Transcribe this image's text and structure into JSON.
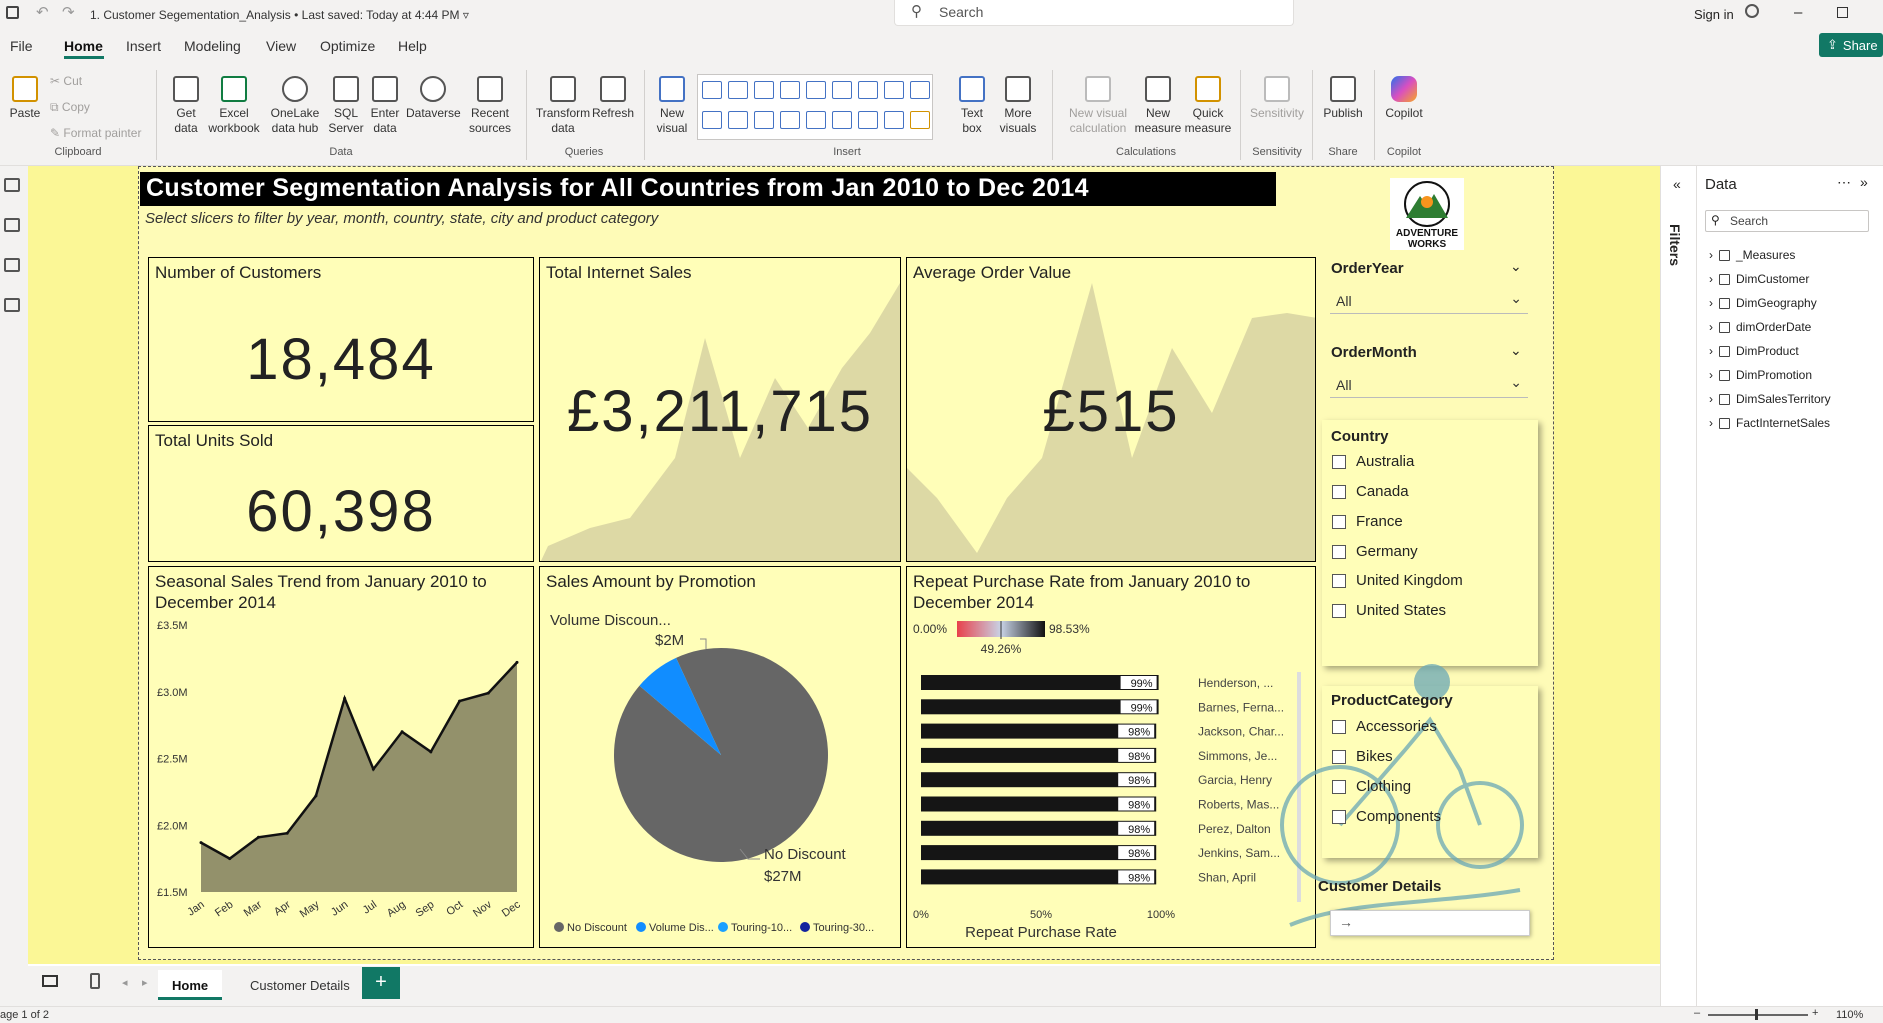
{
  "window": {
    "title": "1. Customer Segementation_Analysis",
    "saved": "• Last saved: Today at 4:44 PM",
    "search_placeholder": "Search",
    "sign_in": "Sign in"
  },
  "menu": {
    "items": [
      "File",
      "Home",
      "Insert",
      "Modeling",
      "View",
      "Optimize",
      "Help"
    ],
    "share": "Share"
  },
  "ribbon": {
    "clipboard": {
      "paste": "Paste",
      "cut": "Cut",
      "copy": "Copy",
      "format_painter": "Format painter",
      "group": "Clipboard"
    },
    "data": {
      "get_data": "Get data",
      "excel": "Excel workbook",
      "onelake": "OneLake data hub",
      "sql": "SQL Server",
      "enter": "Enter data",
      "dataverse": "Dataverse",
      "recent": "Recent sources",
      "group": "Data"
    },
    "queries": {
      "transform": "Transform data",
      "refresh": "Refresh",
      "group": "Queries"
    },
    "insert": {
      "new_visual": "New visual",
      "text_box": "Text box",
      "more_visuals": "More visuals",
      "group": "Insert"
    },
    "calculations": {
      "new_visual_calc": "New visual calculation",
      "new_measure": "New measure",
      "quick_measure": "Quick measure",
      "group": "Calculations"
    },
    "sensitivity": {
      "label": "Sensitivity",
      "group": "Sensitivity"
    },
    "share": {
      "publish": "Publish",
      "group": "Share"
    },
    "copilot": {
      "label": "Copilot",
      "group": "Copilot"
    }
  },
  "report": {
    "title": "Customer Segmentation Analysis for All Countries from Jan 2010 to Dec 2014",
    "subtitle": "Select slicers to filter by year, month, country, state, city and product category",
    "logo_text": "ADVENTURE WORKS",
    "cards": {
      "customers": {
        "label": "Number of Customers",
        "value": "18,484"
      },
      "units": {
        "label": "Total Units Sold",
        "value": "60,398"
      },
      "sales": {
        "label": "Total Internet Sales",
        "value": "£3,211,715"
      },
      "aov": {
        "label": "Average Order Value",
        "value": "£515"
      }
    },
    "slicers": {
      "order_year": {
        "label": "OrderYear",
        "value": "All"
      },
      "order_month": {
        "label": "OrderMonth",
        "value": "All"
      },
      "country": {
        "label": "Country",
        "options": [
          "Australia",
          "Canada",
          "France",
          "Germany",
          "United Kingdom",
          "United States"
        ]
      },
      "product_category": {
        "label": "ProductCategory",
        "options": [
          "Accessories",
          "Bikes",
          "Clothing",
          "Components"
        ]
      }
    },
    "customer_details": {
      "label": "Customer Details"
    }
  },
  "chart_data": [
    {
      "type": "area",
      "title": "Seasonal Sales Trend from January 2010 to December 2014",
      "categories": [
        "Jan",
        "Feb",
        "Mar",
        "Apr",
        "May",
        "Jun",
        "Jul",
        "Aug",
        "Sep",
        "Oct",
        "Nov",
        "Dec"
      ],
      "values": [
        1.87,
        1.75,
        1.91,
        1.94,
        2.22,
        2.95,
        2.42,
        2.7,
        2.55,
        2.93,
        2.99,
        3.22
      ],
      "yticks": [
        "£3.5M",
        "£3.0M",
        "£2.5M",
        "£2.0M",
        "£1.5M"
      ],
      "ylim": [
        1.5,
        3.5
      ],
      "color": "#93916b"
    },
    {
      "type": "pie",
      "title": "Sales Amount by Promotion",
      "slices": [
        {
          "name": "No Discount",
          "value": 27,
          "label": "$27M",
          "color": "#666666"
        },
        {
          "name": "Volume Discoun...",
          "value": 2,
          "label": "$2M",
          "color": "#118dff"
        }
      ],
      "legend": [
        {
          "name": "No Discount",
          "color": "#666666"
        },
        {
          "name": "Volume Dis...",
          "color": "#118dff"
        },
        {
          "name": "Touring-10...",
          "color": "#1aa0ff"
        },
        {
          "name": "Touring-30...",
          "color": "#12239e"
        }
      ]
    },
    {
      "type": "bar",
      "title": "Repeat Purchase Rate from January 2010 to December 2014",
      "categories": [
        "Henderson, ...",
        "Barnes, Ferna...",
        "Jackson, Char...",
        "Simmons, Je...",
        "Garcia, Henry",
        "Roberts, Mas...",
        "Perez, Dalton",
        "Jenkins, Sam...",
        "Shan, April"
      ],
      "values": [
        99,
        99,
        98,
        98,
        98,
        98,
        98,
        98,
        98
      ],
      "labels": [
        "99%",
        "99%",
        "98%",
        "98%",
        "98%",
        "98%",
        "98%",
        "98%",
        "98%"
      ],
      "xticks": [
        "0%",
        "50%",
        "100%"
      ],
      "xlabel": "Repeat Purchase Rate",
      "gradient": {
        "min": "0.00%",
        "mid": "49.26%",
        "max": "98.53%"
      }
    }
  ],
  "data_pane": {
    "title": "Data",
    "search_placeholder": "Search",
    "tables": [
      "_Measures",
      "DimCustomer",
      "DimGeography",
      "dimOrderDate",
      "DimProduct",
      "DimPromotion",
      "DimSalesTerritory",
      "FactInternetSales"
    ]
  },
  "filters_label": "Filters",
  "pages": {
    "tabs": [
      "Home",
      "Customer Details"
    ],
    "status": "age 1 of 2",
    "zoom": "110%"
  }
}
